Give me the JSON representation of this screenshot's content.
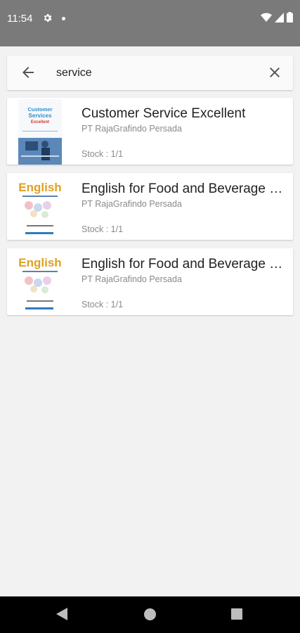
{
  "status_bar": {
    "time": "11:54",
    "icons": [
      "gear-icon",
      "dot-icon",
      "wifi-icon",
      "signal-icon",
      "battery-icon"
    ]
  },
  "search": {
    "query": "service",
    "back_icon": "arrow-left-icon",
    "clear_icon": "close-icon"
  },
  "results": [
    {
      "title": "Customer Service Excellent",
      "publisher": "PT RajaGrafindo Persada",
      "stock": "Stock : 1/1",
      "cover": {
        "top": "Customer",
        "mid": "Services",
        "accent": "Excellent"
      }
    },
    {
      "title": "English for Food and Beverage Services",
      "publisher": "PT RajaGrafindo Persada",
      "stock": "Stock : 1/1",
      "cover": {
        "top": "English",
        "mid": "",
        "accent": ""
      }
    },
    {
      "title": "English for Food and Beverage Services",
      "publisher": "PT RajaGrafindo Persada",
      "stock": "Stock : 1/1",
      "cover": {
        "top": "English",
        "mid": "",
        "accent": ""
      }
    }
  ],
  "nav_bar": {
    "icons": [
      "triangle-back-icon",
      "circle-home-icon",
      "square-recents-icon"
    ]
  },
  "colors": {
    "status_bar": "#7a7a7a",
    "background": "#f2f2f2",
    "card": "#ffffff",
    "nav_bar": "#000000"
  }
}
